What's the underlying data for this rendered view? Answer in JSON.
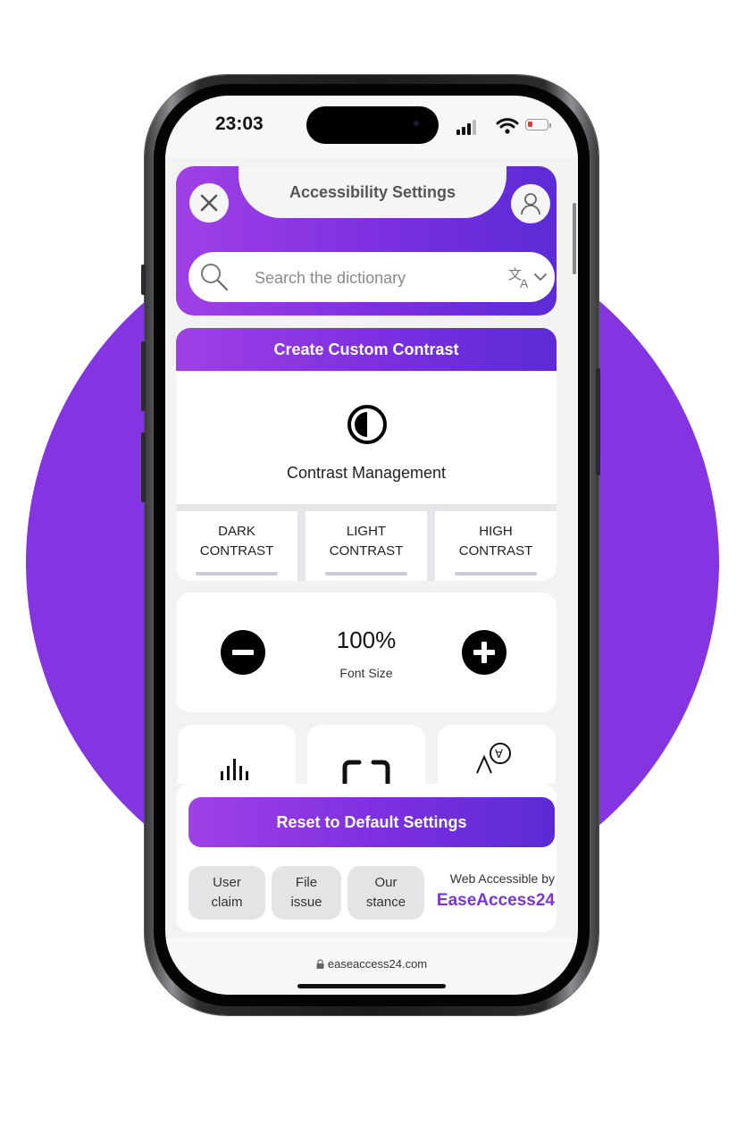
{
  "status_bar": {
    "time": "23:03"
  },
  "header": {
    "title": "Accessibility Settings",
    "close_icon": "close-icon",
    "user_icon": "user-icon"
  },
  "search": {
    "placeholder": "Search the dictionary",
    "value": "",
    "language_icon": "translate-icon"
  },
  "contrast": {
    "header_label": "Create Custom Contrast",
    "title": "Contrast Management",
    "options": [
      {
        "line1": "DARK",
        "line2": "CONTRAST"
      },
      {
        "line1": "LIGHT",
        "line2": "CONTRAST"
      },
      {
        "line1": "HIGH",
        "line2": "CONTRAST"
      }
    ]
  },
  "font_size": {
    "value": "100%",
    "label": "Font Size"
  },
  "tiles": [
    {
      "icon": "audio-wave-icon"
    },
    {
      "icon": "focus-frame-icon"
    },
    {
      "icon": "text-reader-icon"
    }
  ],
  "footer": {
    "reset_label": "Reset to Default Settings",
    "links": [
      {
        "line1": "User",
        "line2": "claim"
      },
      {
        "line1": "File",
        "line2": "issue"
      },
      {
        "line1": "Our",
        "line2": "stance"
      }
    ],
    "powered_text": "Web Accessible by",
    "brand": "EaseAccess24"
  },
  "browser": {
    "url": "easeaccess24.com"
  },
  "colors": {
    "accent": "#8434e0",
    "gradient_start": "#a040e6",
    "gradient_end": "#5b2bd6",
    "brand_text": "#7b35d6"
  }
}
